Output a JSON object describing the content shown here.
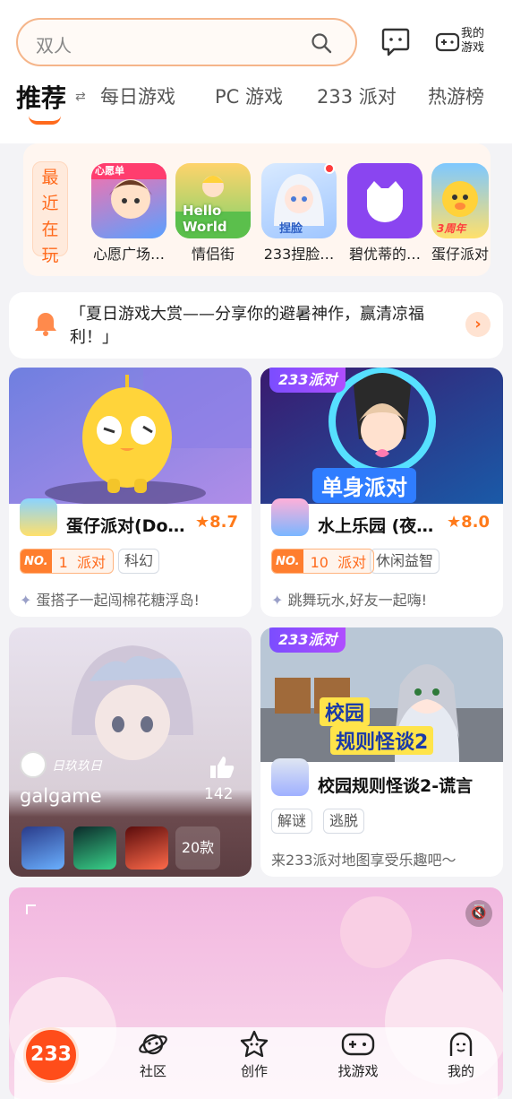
{
  "search": {
    "placeholder": "双人"
  },
  "header": {
    "my_games_label": "我的游戏"
  },
  "tabs": [
    {
      "label": "推荐"
    },
    {
      "label": "每日游戏"
    },
    {
      "label": "PC 游戏"
    },
    {
      "label": "233 派对"
    },
    {
      "label": "热游榜"
    }
  ],
  "recent": {
    "label_chars": [
      "最",
      "近",
      "在",
      "玩"
    ],
    "items": [
      {
        "name": "心愿广场…",
        "thumb_text": "心愿单"
      },
      {
        "name": "情侣街",
        "thumb_text": "Hello World"
      },
      {
        "name": "233捏脸…",
        "thumb_text": "捏脸"
      },
      {
        "name": "碧优蒂的…",
        "thumb_text": ""
      },
      {
        "name": "蛋仔派对",
        "thumb_text": "3周年"
      }
    ]
  },
  "notice": {
    "text": "「夏日游戏大赏——分享你的避暑神作，赢清凉福利！」"
  },
  "cards": [
    {
      "title": "蛋仔派对(Do…",
      "rating": "8.7",
      "rank_no": "NO.",
      "rank_num": "1",
      "rank_cat": "派对",
      "tags": [
        "科幻"
      ],
      "desc": "蛋搭子一起闯棉花糖浮岛!"
    },
    {
      "badge": "233派对",
      "banner_text": "单身派对",
      "title": "水上乐园 (夜…",
      "rating": "8.0",
      "rank_no": "NO.",
      "rank_num": "10",
      "rank_cat": "派对",
      "tags": [
        "休闲益智"
      ],
      "desc": "跳舞玩水,好友一起嗨!"
    },
    {
      "author": "日玖玖日",
      "title": "galgame",
      "likes": "142",
      "count": "20款"
    },
    {
      "badge": "233派对",
      "banner_text_1": "校园",
      "banner_text_2": "规则怪谈2",
      "title": "校园规则怪谈2-谎言",
      "tags": [
        "解谜",
        "逃脱"
      ],
      "desc": "来233派对地图享受乐趣吧～"
    }
  ],
  "nav": {
    "home": "233",
    "items": [
      {
        "label": "社区",
        "icon": "planet-icon"
      },
      {
        "label": "创作",
        "icon": "star-icon"
      },
      {
        "label": "找游戏",
        "icon": "gamepad-icon"
      },
      {
        "label": "我的",
        "icon": "face-icon"
      }
    ]
  },
  "colors": {
    "accent": "#ff6a1c",
    "rating": "#ff7a1a",
    "party": "#7b4dff"
  }
}
